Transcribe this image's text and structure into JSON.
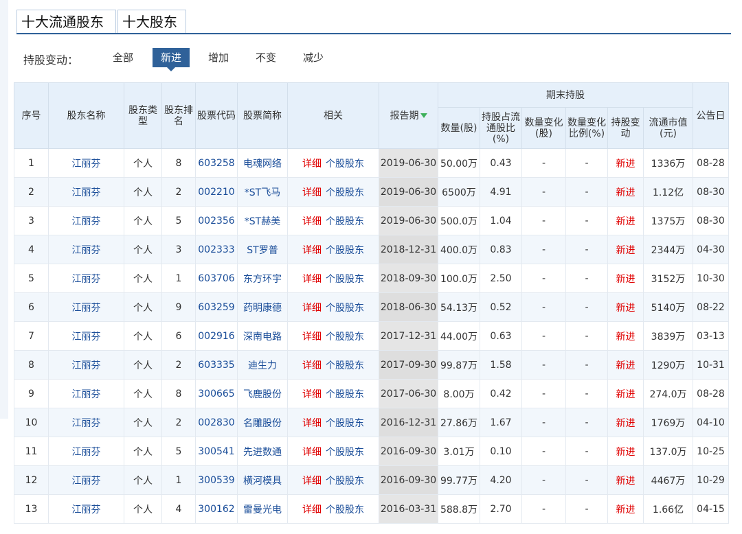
{
  "tabs": [
    {
      "label": "十大流通股东",
      "active": true
    },
    {
      "label": "十大股东",
      "active": false
    }
  ],
  "filter": {
    "label": "持股变动：",
    "options": [
      {
        "label": "全部",
        "active": false
      },
      {
        "label": "新进",
        "active": true
      },
      {
        "label": "增加",
        "active": false
      },
      {
        "label": "不变",
        "active": false
      },
      {
        "label": "减少",
        "active": false
      }
    ]
  },
  "table": {
    "headers": {
      "seq": "序号",
      "holder_name": "股东名称",
      "holder_type": "股东类型",
      "holder_rank": "股东排名",
      "stock_code": "股票代码",
      "stock_name": "股票简称",
      "related": "相关",
      "report_date": "报告期",
      "group_end": "期末持股",
      "quantity": "数量(股)",
      "ratio": "持股占流通股比(%)",
      "qty_change": "数量变化(股)",
      "qty_change_ratio": "数量变化比例(%)",
      "change": "持股变动",
      "market_value": "流通市值(元)",
      "announce_date": "公告日"
    },
    "detail_label": "详细",
    "stock_holders_label": "个股股东",
    "rows": [
      {
        "seq": "1",
        "name": "江丽芬",
        "type": "个人",
        "rank": "8",
        "code": "603258",
        "stock": "电魂网络",
        "date": "2019-06-30",
        "qty": "50.00万",
        "ratio": "0.43",
        "qchg": "-",
        "qchgr": "-",
        "chg": "新进",
        "mv": "1336万",
        "ann": "08-28"
      },
      {
        "seq": "2",
        "name": "江丽芬",
        "type": "个人",
        "rank": "2",
        "code": "002210",
        "stock": "*ST飞马",
        "date": "2019-06-30",
        "qty": "6500万",
        "ratio": "4.91",
        "qchg": "-",
        "qchgr": "-",
        "chg": "新进",
        "mv": "1.12亿",
        "ann": "08-30"
      },
      {
        "seq": "3",
        "name": "江丽芬",
        "type": "个人",
        "rank": "5",
        "code": "002356",
        "stock": "*ST赫美",
        "date": "2019-06-30",
        "qty": "500.0万",
        "ratio": "1.04",
        "qchg": "-",
        "qchgr": "-",
        "chg": "新进",
        "mv": "1375万",
        "ann": "08-30"
      },
      {
        "seq": "4",
        "name": "江丽芬",
        "type": "个人",
        "rank": "3",
        "code": "002333",
        "stock": "ST罗普",
        "date": "2018-12-31",
        "qty": "400.0万",
        "ratio": "0.83",
        "qchg": "-",
        "qchgr": "-",
        "chg": "新进",
        "mv": "2344万",
        "ann": "04-30"
      },
      {
        "seq": "5",
        "name": "江丽芬",
        "type": "个人",
        "rank": "1",
        "code": "603706",
        "stock": "东方环宇",
        "date": "2018-09-30",
        "qty": "100.0万",
        "ratio": "2.50",
        "qchg": "-",
        "qchgr": "-",
        "chg": "新进",
        "mv": "3152万",
        "ann": "10-30"
      },
      {
        "seq": "6",
        "name": "江丽芬",
        "type": "个人",
        "rank": "9",
        "code": "603259",
        "stock": "药明康德",
        "date": "2018-06-30",
        "qty": "54.13万",
        "ratio": "0.52",
        "qchg": "-",
        "qchgr": "-",
        "chg": "新进",
        "mv": "5140万",
        "ann": "08-22"
      },
      {
        "seq": "7",
        "name": "江丽芬",
        "type": "个人",
        "rank": "6",
        "code": "002916",
        "stock": "深南电路",
        "date": "2017-12-31",
        "qty": "44.00万",
        "ratio": "0.63",
        "qchg": "-",
        "qchgr": "-",
        "chg": "新进",
        "mv": "3839万",
        "ann": "03-13"
      },
      {
        "seq": "8",
        "name": "江丽芬",
        "type": "个人",
        "rank": "2",
        "code": "603335",
        "stock": "迪生力",
        "date": "2017-09-30",
        "qty": "99.87万",
        "ratio": "1.58",
        "qchg": "-",
        "qchgr": "-",
        "chg": "新进",
        "mv": "1290万",
        "ann": "10-31"
      },
      {
        "seq": "9",
        "name": "江丽芬",
        "type": "个人",
        "rank": "8",
        "code": "300665",
        "stock": "飞鹿股份",
        "date": "2017-06-30",
        "qty": "8.00万",
        "ratio": "0.42",
        "qchg": "-",
        "qchgr": "-",
        "chg": "新进",
        "mv": "274.0万",
        "ann": "08-28"
      },
      {
        "seq": "10",
        "name": "江丽芬",
        "type": "个人",
        "rank": "2",
        "code": "002830",
        "stock": "名雕股份",
        "date": "2016-12-31",
        "qty": "27.86万",
        "ratio": "1.67",
        "qchg": "-",
        "qchgr": "-",
        "chg": "新进",
        "mv": "1769万",
        "ann": "04-10"
      },
      {
        "seq": "11",
        "name": "江丽芬",
        "type": "个人",
        "rank": "5",
        "code": "300541",
        "stock": "先进数通",
        "date": "2016-09-30",
        "qty": "3.01万",
        "ratio": "0.10",
        "qchg": "-",
        "qchgr": "-",
        "chg": "新进",
        "mv": "137.0万",
        "ann": "10-25"
      },
      {
        "seq": "12",
        "name": "江丽芬",
        "type": "个人",
        "rank": "1",
        "code": "300539",
        "stock": "横河模具",
        "date": "2016-09-30",
        "qty": "99.77万",
        "ratio": "4.20",
        "qchg": "-",
        "qchgr": "-",
        "chg": "新进",
        "mv": "4467万",
        "ann": "10-29"
      },
      {
        "seq": "13",
        "name": "江丽芬",
        "type": "个人",
        "rank": "4",
        "code": "300162",
        "stock": "雷曼光电",
        "date": "2016-03-31",
        "qty": "588.8万",
        "ratio": "2.70",
        "qchg": "-",
        "qchgr": "-",
        "chg": "新进",
        "mv": "1.66亿",
        "ann": "04-15"
      }
    ]
  },
  "colors": {
    "accent": "#2f6199",
    "header_bg": "#e6f0fa",
    "link": "#1a4d99",
    "red": "#e00000",
    "sort_arrow": "#3db05a"
  }
}
